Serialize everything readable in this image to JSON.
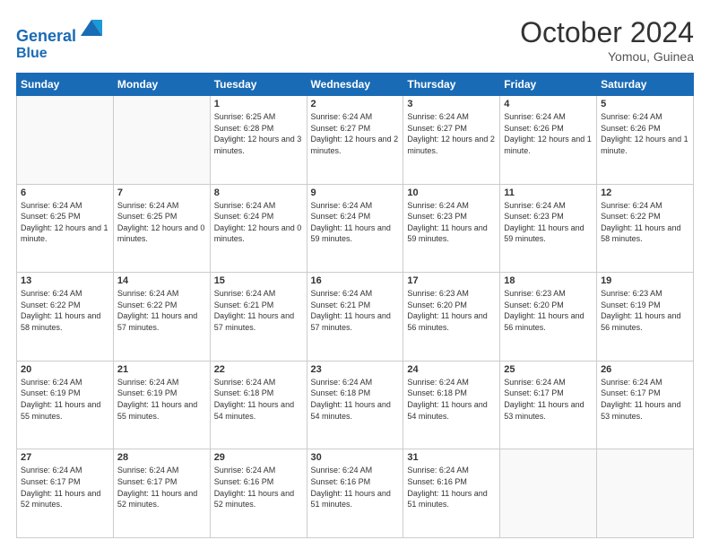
{
  "header": {
    "logo_line1": "General",
    "logo_line2": "Blue",
    "month_title": "October 2024",
    "location": "Yomou, Guinea"
  },
  "weekdays": [
    "Sunday",
    "Monday",
    "Tuesday",
    "Wednesday",
    "Thursday",
    "Friday",
    "Saturday"
  ],
  "weeks": [
    [
      {
        "day": "",
        "info": ""
      },
      {
        "day": "",
        "info": ""
      },
      {
        "day": "1",
        "info": "Sunrise: 6:25 AM\nSunset: 6:28 PM\nDaylight: 12 hours and 3 minutes."
      },
      {
        "day": "2",
        "info": "Sunrise: 6:24 AM\nSunset: 6:27 PM\nDaylight: 12 hours and 2 minutes."
      },
      {
        "day": "3",
        "info": "Sunrise: 6:24 AM\nSunset: 6:27 PM\nDaylight: 12 hours and 2 minutes."
      },
      {
        "day": "4",
        "info": "Sunrise: 6:24 AM\nSunset: 6:26 PM\nDaylight: 12 hours and 1 minute."
      },
      {
        "day": "5",
        "info": "Sunrise: 6:24 AM\nSunset: 6:26 PM\nDaylight: 12 hours and 1 minute."
      }
    ],
    [
      {
        "day": "6",
        "info": "Sunrise: 6:24 AM\nSunset: 6:25 PM\nDaylight: 12 hours and 1 minute."
      },
      {
        "day": "7",
        "info": "Sunrise: 6:24 AM\nSunset: 6:25 PM\nDaylight: 12 hours and 0 minutes."
      },
      {
        "day": "8",
        "info": "Sunrise: 6:24 AM\nSunset: 6:24 PM\nDaylight: 12 hours and 0 minutes."
      },
      {
        "day": "9",
        "info": "Sunrise: 6:24 AM\nSunset: 6:24 PM\nDaylight: 11 hours and 59 minutes."
      },
      {
        "day": "10",
        "info": "Sunrise: 6:24 AM\nSunset: 6:23 PM\nDaylight: 11 hours and 59 minutes."
      },
      {
        "day": "11",
        "info": "Sunrise: 6:24 AM\nSunset: 6:23 PM\nDaylight: 11 hours and 59 minutes."
      },
      {
        "day": "12",
        "info": "Sunrise: 6:24 AM\nSunset: 6:22 PM\nDaylight: 11 hours and 58 minutes."
      }
    ],
    [
      {
        "day": "13",
        "info": "Sunrise: 6:24 AM\nSunset: 6:22 PM\nDaylight: 11 hours and 58 minutes."
      },
      {
        "day": "14",
        "info": "Sunrise: 6:24 AM\nSunset: 6:22 PM\nDaylight: 11 hours and 57 minutes."
      },
      {
        "day": "15",
        "info": "Sunrise: 6:24 AM\nSunset: 6:21 PM\nDaylight: 11 hours and 57 minutes."
      },
      {
        "day": "16",
        "info": "Sunrise: 6:24 AM\nSunset: 6:21 PM\nDaylight: 11 hours and 57 minutes."
      },
      {
        "day": "17",
        "info": "Sunrise: 6:23 AM\nSunset: 6:20 PM\nDaylight: 11 hours and 56 minutes."
      },
      {
        "day": "18",
        "info": "Sunrise: 6:23 AM\nSunset: 6:20 PM\nDaylight: 11 hours and 56 minutes."
      },
      {
        "day": "19",
        "info": "Sunrise: 6:23 AM\nSunset: 6:19 PM\nDaylight: 11 hours and 56 minutes."
      }
    ],
    [
      {
        "day": "20",
        "info": "Sunrise: 6:24 AM\nSunset: 6:19 PM\nDaylight: 11 hours and 55 minutes."
      },
      {
        "day": "21",
        "info": "Sunrise: 6:24 AM\nSunset: 6:19 PM\nDaylight: 11 hours and 55 minutes."
      },
      {
        "day": "22",
        "info": "Sunrise: 6:24 AM\nSunset: 6:18 PM\nDaylight: 11 hours and 54 minutes."
      },
      {
        "day": "23",
        "info": "Sunrise: 6:24 AM\nSunset: 6:18 PM\nDaylight: 11 hours and 54 minutes."
      },
      {
        "day": "24",
        "info": "Sunrise: 6:24 AM\nSunset: 6:18 PM\nDaylight: 11 hours and 54 minutes."
      },
      {
        "day": "25",
        "info": "Sunrise: 6:24 AM\nSunset: 6:17 PM\nDaylight: 11 hours and 53 minutes."
      },
      {
        "day": "26",
        "info": "Sunrise: 6:24 AM\nSunset: 6:17 PM\nDaylight: 11 hours and 53 minutes."
      }
    ],
    [
      {
        "day": "27",
        "info": "Sunrise: 6:24 AM\nSunset: 6:17 PM\nDaylight: 11 hours and 52 minutes."
      },
      {
        "day": "28",
        "info": "Sunrise: 6:24 AM\nSunset: 6:17 PM\nDaylight: 11 hours and 52 minutes."
      },
      {
        "day": "29",
        "info": "Sunrise: 6:24 AM\nSunset: 6:16 PM\nDaylight: 11 hours and 52 minutes."
      },
      {
        "day": "30",
        "info": "Sunrise: 6:24 AM\nSunset: 6:16 PM\nDaylight: 11 hours and 51 minutes."
      },
      {
        "day": "31",
        "info": "Sunrise: 6:24 AM\nSunset: 6:16 PM\nDaylight: 11 hours and 51 minutes."
      },
      {
        "day": "",
        "info": ""
      },
      {
        "day": "",
        "info": ""
      }
    ]
  ]
}
